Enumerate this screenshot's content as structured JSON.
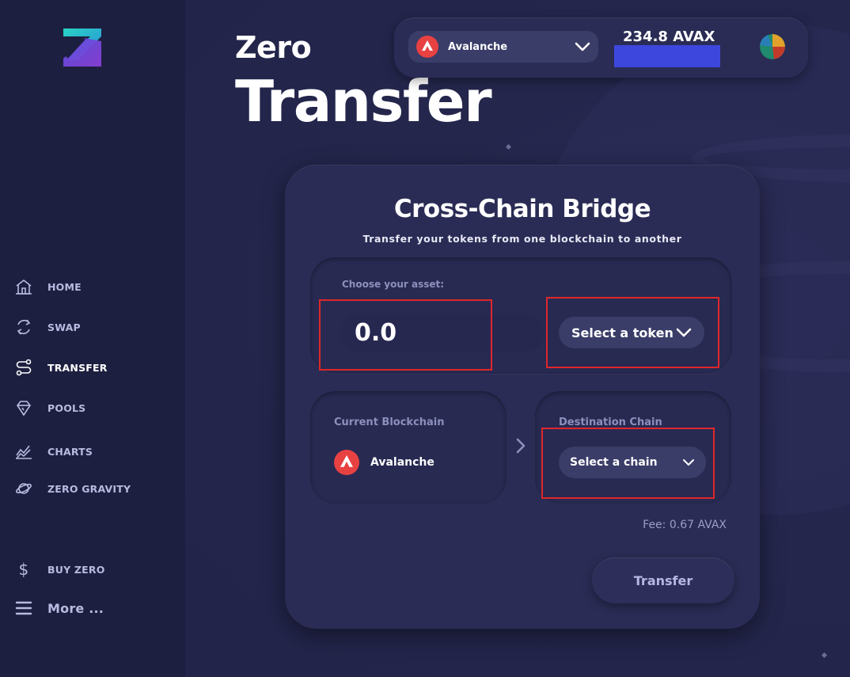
{
  "nav": {
    "home": "HOME",
    "swap": "SWAP",
    "transfer": "TRANSFER",
    "pools": "POOLS",
    "charts": "CHARTS",
    "zero_gravity": "ZERO GRAVITY",
    "buy_zero": "BUY ZERO",
    "more": "More ..."
  },
  "header": {
    "title_small": "Zero",
    "title_big": "Transfer"
  },
  "wallet": {
    "network": "Avalanche",
    "balance": "234.8 AVAX"
  },
  "bridge": {
    "title": "Cross-Chain Bridge",
    "subtitle": "Transfer your tokens from one blockchain to another",
    "asset_label": "Choose your asset:",
    "amount_value": "0.0",
    "token_select_label": "Select a token",
    "current_chain_label": "Current Blockchain",
    "current_chain_value": "Avalanche",
    "destination_chain_label": "Destination Chain",
    "chain_select_label": "Select a chain",
    "fee": "Fee: 0.67 AVAX",
    "transfer_button": "Transfer"
  },
  "colors": {
    "sidebar_bg": "#1d1f40",
    "main_bg": "#22244a",
    "card_bg": "#2a2c55",
    "highlight": "#e0262a",
    "balance_bar": "#3d47de",
    "avalanche_red": "#e84142",
    "logo_teal": "#29c8c6",
    "logo_purple": "#7a4ad8"
  }
}
